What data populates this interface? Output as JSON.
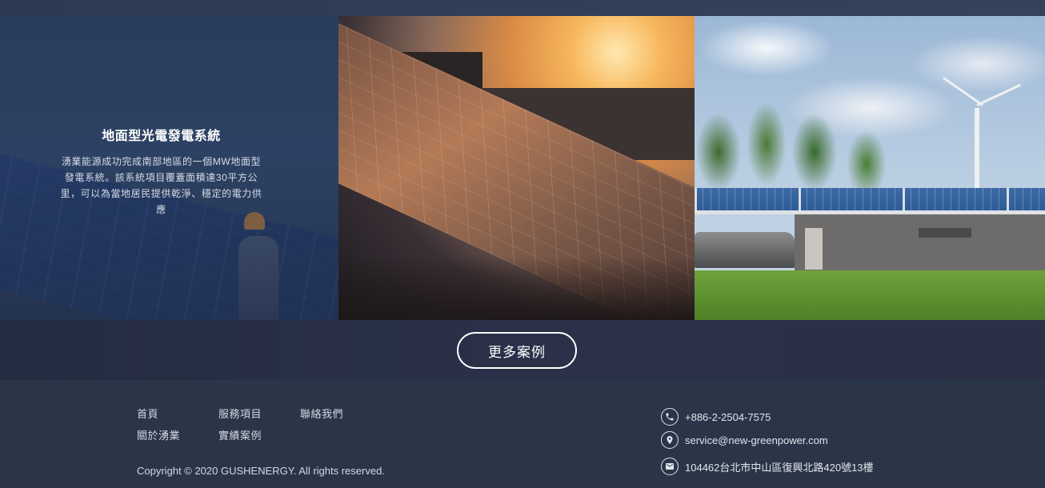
{
  "project_card": {
    "title": "地面型光電發電系統",
    "description": "湧業能源成功完成南部地區的一個MW地面型發電系統。該系統項目覆蓋面積達30平方公里，可以為當地居民提供乾淨、穩定的電力供應"
  },
  "more_button": {
    "label": "更多案例"
  },
  "footer": {
    "nav": {
      "home": "首頁",
      "services": "服務項目",
      "contact": "聯絡我們",
      "about": "關於湧業",
      "cases": "實績案例"
    },
    "copyright": "Copyright © 2020 GUSHENERGY. All rights reserved.",
    "contact": {
      "phone": "+886-2-2504-7575",
      "email": "service@new-greenpower.com",
      "address": "104462台北市中山區復興北路420號13樓"
    },
    "icons": {
      "phone": "phone-icon",
      "email": "location-pin-icon",
      "address": "mail-icon"
    }
  }
}
